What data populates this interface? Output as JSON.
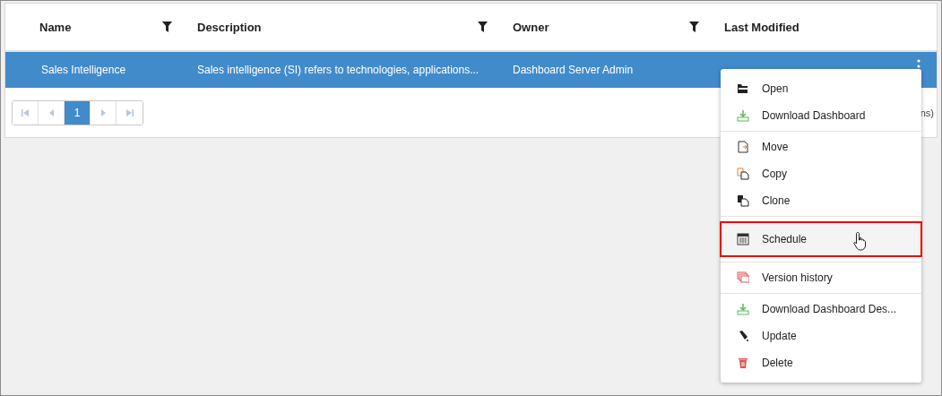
{
  "grid": {
    "columns": [
      {
        "label": "Name",
        "filter": true
      },
      {
        "label": "Description",
        "filter": true
      },
      {
        "label": "Owner",
        "filter": true
      },
      {
        "label": "Last Modified",
        "filter": false
      }
    ],
    "rows": [
      {
        "selected": true,
        "cells": [
          "Sales Intelligence",
          "Sales intelligence (SI) refers to technologies, applications...",
          "Dashboard Server Admin"
        ]
      }
    ]
  },
  "pager": {
    "pages": [
      {
        "kind": "first",
        "selected": false
      },
      {
        "kind": "prev",
        "selected": false
      },
      {
        "kind": "page",
        "label": "1",
        "selected": true
      },
      {
        "kind": "next",
        "selected": false
      },
      {
        "kind": "last",
        "selected": false
      }
    ],
    "info": "ns)"
  },
  "menu": {
    "groups": [
      [
        {
          "kind": "open",
          "label": "Open",
          "highlighted": false
        },
        {
          "kind": "download",
          "label": "Download Dashboard",
          "highlighted": false
        }
      ],
      [
        {
          "kind": "move",
          "label": "Move",
          "highlighted": false
        },
        {
          "kind": "copy",
          "label": "Copy",
          "highlighted": false
        },
        {
          "kind": "clone",
          "label": "Clone",
          "highlighted": false
        }
      ],
      [
        {
          "kind": "schedule",
          "label": "Schedule",
          "highlighted": true
        }
      ],
      [
        {
          "kind": "history",
          "label": "Version history",
          "highlighted": false
        }
      ],
      [
        {
          "kind": "download",
          "label": "Download Dashboard Des...",
          "highlighted": false
        },
        {
          "kind": "update",
          "label": "Update",
          "highlighted": false
        },
        {
          "kind": "delete",
          "label": "Delete",
          "highlighted": false
        }
      ]
    ]
  }
}
